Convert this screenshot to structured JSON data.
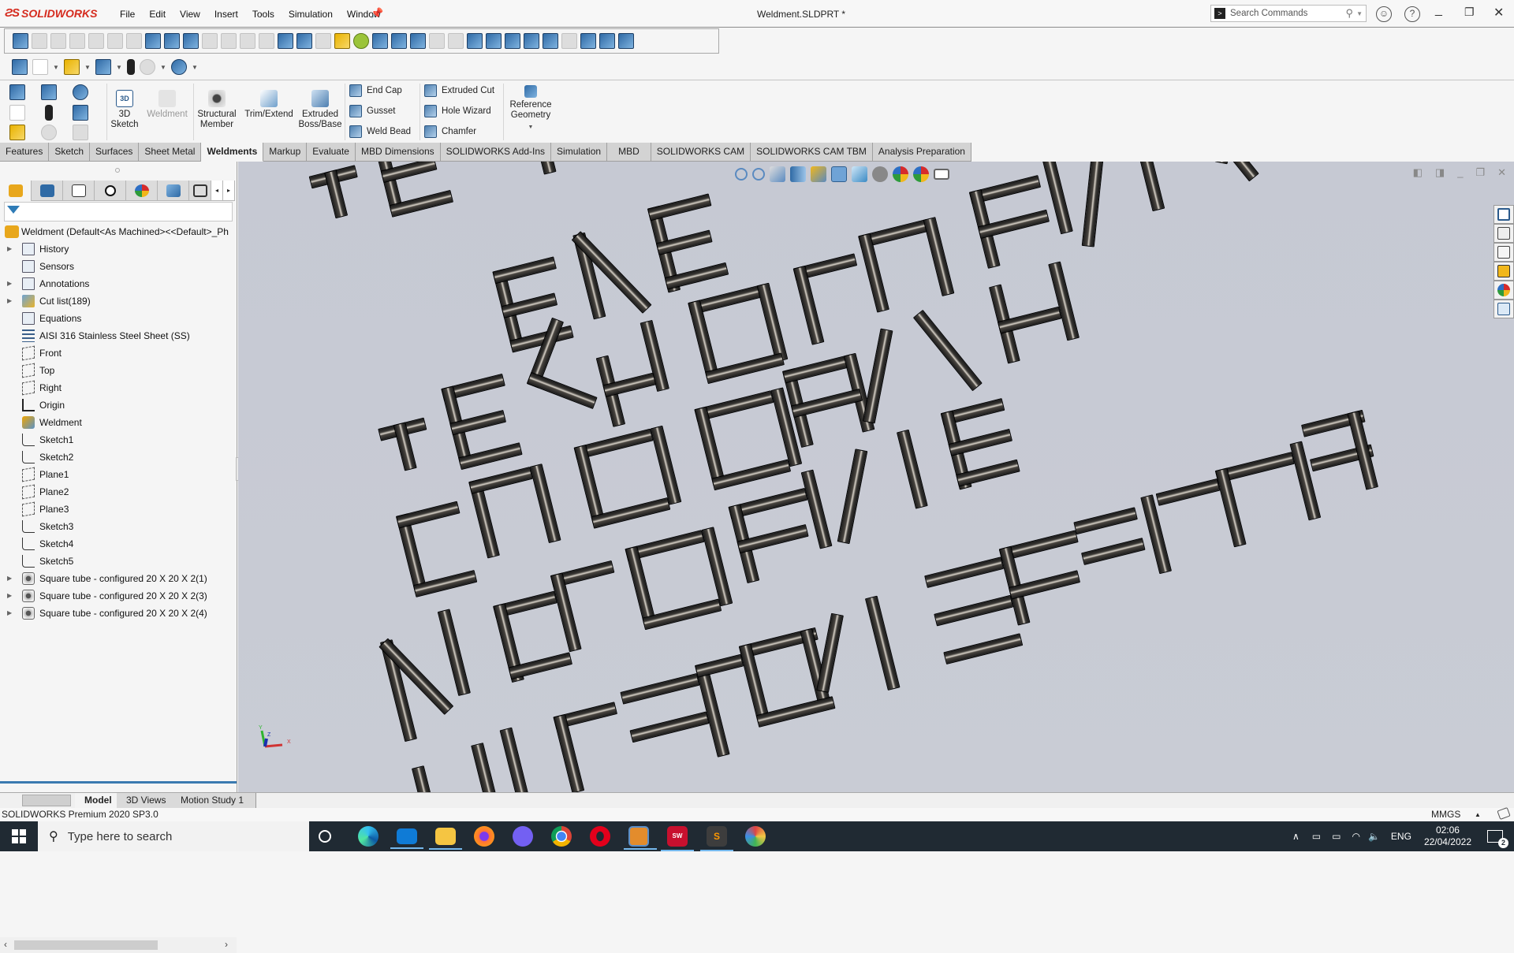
{
  "app": {
    "brand": "SOLIDWORKS",
    "document_title": "Weldment.SLDPRT *",
    "menu": [
      "File",
      "Edit",
      "View",
      "Insert",
      "Tools",
      "Simulation",
      "Window"
    ],
    "search_placeholder": "Search Commands",
    "icons": [
      "pin-icon",
      "user-account-icon",
      "help-icon",
      "minimize-icon",
      "restore-icon",
      "close-icon"
    ]
  },
  "ribbon": {
    "buttons": {
      "sketch3d": "3D Sketch",
      "weldment": "Weldment",
      "structural_member": "Structural Member",
      "trim_extend": "Trim/Extend",
      "extruded_boss": "Extruded Boss/Base",
      "end_cap": "End Cap",
      "gusset": "Gusset",
      "weld_bead": "Weld Bead",
      "extruded_cut": "Extruded Cut",
      "hole_wizard": "Hole Wizard",
      "chamfer": "Chamfer",
      "reference_geometry": "Reference Geometry"
    },
    "tabs": [
      {
        "label": "Features",
        "active": false
      },
      {
        "label": "Sketch",
        "active": false
      },
      {
        "label": "Surfaces",
        "active": false
      },
      {
        "label": "Sheet Metal",
        "active": false
      },
      {
        "label": "Weldments",
        "active": true
      },
      {
        "label": "Markup",
        "active": false
      },
      {
        "label": "Evaluate",
        "active": false
      },
      {
        "label": "MBD Dimensions",
        "active": false
      },
      {
        "label": "SOLIDWORKS Add-Ins",
        "active": false
      },
      {
        "label": "Simulation",
        "active": false
      },
      {
        "label": "MBD",
        "active": false
      },
      {
        "label": "SOLIDWORKS CAM",
        "active": false
      },
      {
        "label": "SOLIDWORKS CAM TBM",
        "active": false
      },
      {
        "label": "Analysis Preparation",
        "active": false
      }
    ]
  },
  "feature_tree": {
    "root": "Weldment  (Default<As Machined><<Default>_Ph",
    "items": [
      {
        "label": "History",
        "icon": "history-folder",
        "expandable": true
      },
      {
        "label": "Sensors",
        "icon": "sensors-folder",
        "expandable": false
      },
      {
        "label": "Annotations",
        "icon": "annotations-folder",
        "expandable": true
      },
      {
        "label": "Cut list(189)",
        "icon": "cut-list",
        "expandable": true
      },
      {
        "label": "Equations",
        "icon": "equations-folder",
        "expandable": false
      },
      {
        "label": "AISI 316 Stainless Steel Sheet (SS)",
        "icon": "material",
        "expandable": false
      },
      {
        "label": "Front",
        "icon": "plane",
        "expandable": false
      },
      {
        "label": "Top",
        "icon": "plane",
        "expandable": false
      },
      {
        "label": "Right",
        "icon": "plane",
        "expandable": false
      },
      {
        "label": "Origin",
        "icon": "origin",
        "expandable": false
      },
      {
        "label": "Weldment",
        "icon": "weldment",
        "expandable": false
      },
      {
        "label": "Sketch1",
        "icon": "sketch",
        "expandable": false
      },
      {
        "label": "Sketch2",
        "icon": "sketch",
        "expandable": false
      },
      {
        "label": "Plane1",
        "icon": "plane",
        "expandable": false
      },
      {
        "label": "Plane2",
        "icon": "plane",
        "expandable": false
      },
      {
        "label": "Plane3",
        "icon": "plane",
        "expandable": false
      },
      {
        "label": "Sketch3",
        "icon": "sketch",
        "expandable": false
      },
      {
        "label": "Sketch4",
        "icon": "sketch",
        "expandable": false
      },
      {
        "label": "Sketch5",
        "icon": "sketch",
        "expandable": false
      },
      {
        "label": "Square tube - configured 20 X 20 X 2(1)",
        "icon": "structural-member",
        "expandable": true
      },
      {
        "label": "Square tube - configured 20 X 20 X 2(3)",
        "icon": "structural-member",
        "expandable": true
      },
      {
        "label": "Square tube - configured 20 X 20 X 2(4)",
        "icon": "structural-member",
        "expandable": true
      }
    ]
  },
  "viewport": {
    "triad_labels": {
      "x": "X",
      "y": "Y",
      "z": "Z"
    },
    "model_description": "Weldment of square tubes forming stylized lettering"
  },
  "bottom_tabs": [
    {
      "label": "Model",
      "active": true
    },
    {
      "label": "3D Views",
      "active": false
    },
    {
      "label": "Motion Study 1",
      "active": false
    }
  ],
  "status": {
    "version": "SOLIDWORKS Premium 2020 SP3.0",
    "units": "MMGS"
  },
  "taskbar": {
    "search_placeholder": "Type here to search",
    "apps": [
      "cortana",
      "edge",
      "mail",
      "file-explorer",
      "firefox",
      "viber",
      "chrome",
      "opera",
      "media-player",
      "solidworks-2020",
      "sublime-text",
      "paint"
    ],
    "language": "ENG",
    "time": "02:06",
    "date": "22/04/2022",
    "notifications": "2"
  }
}
